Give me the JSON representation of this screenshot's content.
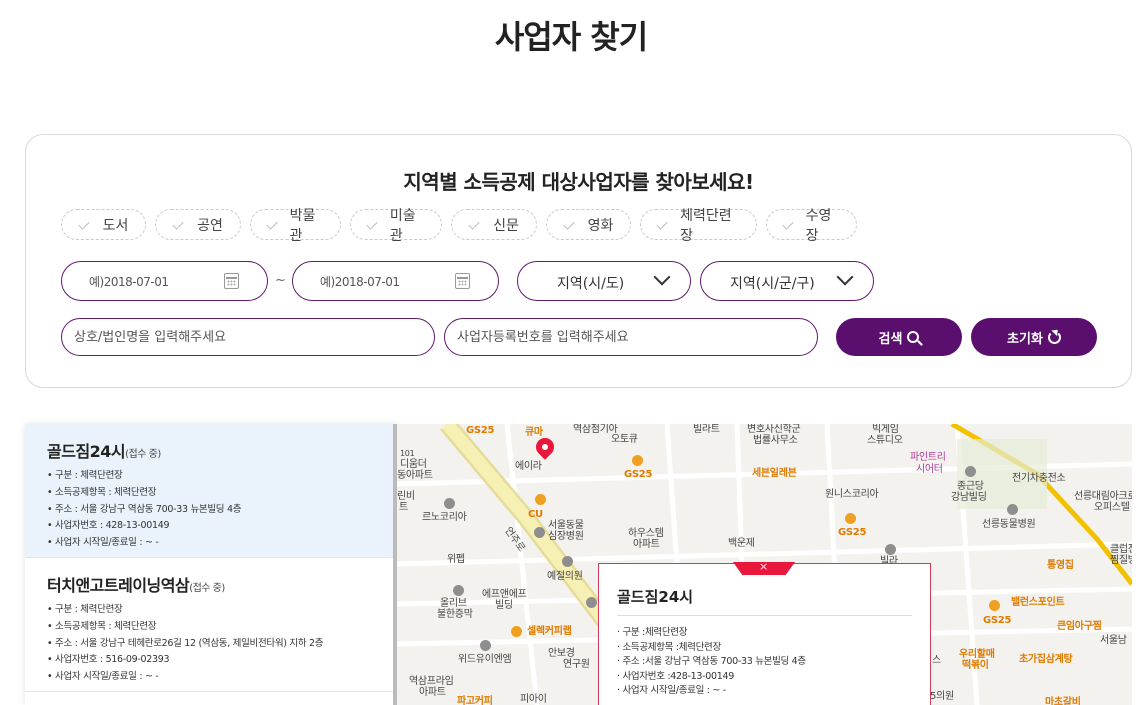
{
  "page_title": "사업자 찾기",
  "search": {
    "heading": "지역별 소득공제 대상사업자를 찾아보세요!",
    "categories": [
      "도서",
      "공연",
      "박물관",
      "미술관",
      "신문",
      "영화",
      "체력단련장",
      "수영장"
    ],
    "date_from": "예)2018-07-01",
    "date_to": "예)2018-07-01",
    "date_separator": "~",
    "region_sido": "지역(시/도)",
    "region_sigungu": "지역(시/군/구)",
    "name_placeholder": "상호/법인명을 입력해주세요",
    "bizno_placeholder": "사업자등록번호를 입력해주세요",
    "search_label": "검색",
    "reset_label": "초기화"
  },
  "results": [
    {
      "name": "골드짐24시",
      "status": "(접수 중)",
      "lines": [
        "• 구분 : 체력단련장",
        "• 소득공제항목 : 체력단련장",
        "• 주소 : 서울 강남구 역삼동 700-33 뉴본빌딩 4층",
        "• 사업자번호 : 428-13-00149",
        "• 사업자 시작일/종료일 :  ~ -"
      ]
    },
    {
      "name": "터치앤고트레이닝역삼",
      "status": "(접수 중)",
      "lines": [
        "• 구분 : 체력단련장",
        "• 소득공제항목 : 체력단련장",
        "• 주소 : 서울 강남구 테헤란로26길 12 (역삼동, 제일비전타워) 지하 2층",
        "• 사업자번호 : 516-09-02393",
        "• 사업자 시작일/종료일 :  ~ -"
      ]
    }
  ],
  "popup": {
    "close": "×",
    "title": "골드짐24시",
    "lines": [
      "· 구분 :체력단련장",
      "· 소득공제항목 :체력단련장",
      "· 주소 :서울 강남구 역삼동 700-33 뉴본빌딩 4층",
      "· 사업자번호 :428-13-00149",
      "· 사업자 시작일/종료일 : ~ -"
    ]
  },
  "map": {
    "labels": [
      "GS25",
      "큐마",
      "역삼점기아",
      "오토큐",
      "빌라트",
      "변호사신학군",
      "법률사무소",
      "빅게임",
      "스튜디오",
      "파인트리",
      "시어터",
      "101",
      "디움더",
      "동아파트",
      "에이라",
      "GS25",
      "세븐일레븐",
      "종근당",
      "강남빌딩",
      "전기차충전소",
      "선릉대림아크로",
      "오피스텔",
      "린비",
      "트",
      "르노코리아",
      "CU",
      "서울동물",
      "심장병원",
      "하우스템",
      "아파트",
      "원니스코리아",
      "선릉동물병원",
      "GS25",
      "백운제",
      "위펩",
      "예절의원",
      "클럽진",
      "찜질방",
      "빌라",
      "올리브",
      "불한증막",
      "에프앤에프",
      "빌딩",
      "통영집",
      "셀렉커피랩",
      "밸런스포인트",
      "GS25",
      "큰임아구찜",
      "서울남",
      "위드유이엔엠",
      "안보경",
      "연구원",
      "우리할매",
      "떡볶이",
      "초가집삼계탕",
      "역삼프라임",
      "아파트",
      "피아이",
      "파고커피",
      "스",
      "5의원",
      "마초갈비",
      "언주로"
    ]
  }
}
